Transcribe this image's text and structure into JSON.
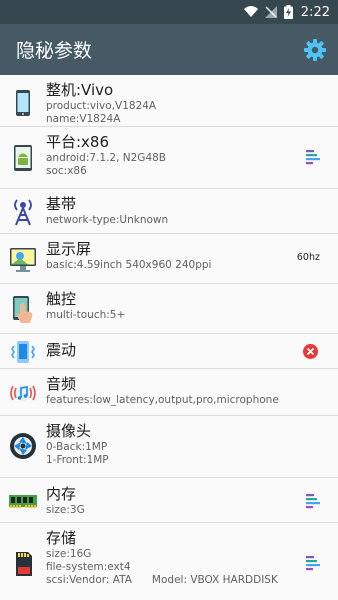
{
  "status": {
    "time": "2:22"
  },
  "app": {
    "title": "隐秘参数"
  },
  "items": [
    {
      "title": "整机:Vivo",
      "lines": [
        "product:vivo,V1824A",
        "name:V1824A"
      ]
    },
    {
      "title": "平台:x86",
      "lines": [
        "android:7.1.2, N2G48B",
        "soc:x86"
      ]
    },
    {
      "title": "基带",
      "lines": [
        "network-type:Unknown"
      ]
    },
    {
      "title": "显示屏",
      "lines": [
        "basic:4.59inch 540x960 240ppi"
      ],
      "trail_text": "60hz"
    },
    {
      "title": "触控",
      "lines": [
        "multi-touch:5+"
      ]
    },
    {
      "title": "震动",
      "lines": []
    },
    {
      "title": "音频",
      "lines": [
        "features:low_latency,output,pro,microphone"
      ]
    },
    {
      "title": "摄像头",
      "lines": [
        "0-Back:1MP",
        "1-Front:1MP"
      ]
    },
    {
      "title": "内存",
      "lines": [
        "size:3G"
      ]
    },
    {
      "title": "存储",
      "lines": [
        "size:16G",
        "file-system:ext4",
        "scsi:Vendor: ATA      Model: VBOX HARDDISK"
      ]
    }
  ],
  "colors": {
    "status_bar": "#37474f",
    "app_bar": "#455a64",
    "error_badge": "#e53935"
  }
}
